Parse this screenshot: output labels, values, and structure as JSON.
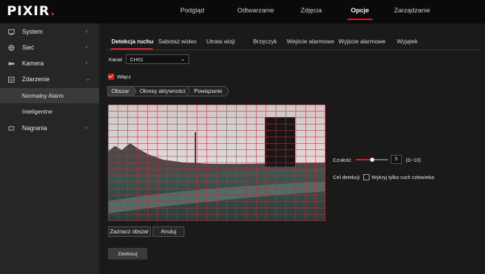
{
  "brand": {
    "logo_text": "PIXIR",
    "logo_dot": ".",
    "accent_color": "#d71920"
  },
  "topnav": {
    "items": [
      {
        "label": "Podgląd"
      },
      {
        "label": "Odtwarzanie"
      },
      {
        "label": "Zdjęcia"
      },
      {
        "label": "Opcje",
        "active": true
      },
      {
        "label": "Zarządzanie"
      }
    ]
  },
  "sidebar": {
    "items": [
      {
        "label": "System",
        "icon": "system-icon",
        "chevron": "›"
      },
      {
        "label": "Sieć",
        "icon": "network-icon",
        "chevron": "›"
      },
      {
        "label": "Kamera",
        "icon": "camera-icon",
        "chevron": "›"
      },
      {
        "label": "Zdarzenie",
        "icon": "event-icon",
        "chevron": "⌄",
        "expanded": true
      },
      {
        "label": "Nagrania",
        "icon": "recordings-icon",
        "chevron": "›"
      }
    ],
    "subitems": [
      {
        "label": "Normalny Alarm",
        "active": true
      },
      {
        "label": "Inteligentne"
      }
    ]
  },
  "tabs": [
    {
      "label": "Detekcja ruchu",
      "active": true
    },
    {
      "label": "Sabotaż wideo"
    },
    {
      "label": "Utrata wizji"
    },
    {
      "label": "Brzęczyk"
    },
    {
      "label": "Wejście alarmowe"
    },
    {
      "label": "Wyjście alarmowe"
    },
    {
      "label": "Wyjątek"
    }
  ],
  "channel": {
    "label": "Kanał",
    "value": "CH01"
  },
  "enable": {
    "label": "Włącz",
    "checked": true
  },
  "steps": [
    {
      "label": "Obszar",
      "active": true
    },
    {
      "label": "Okresy aktywności"
    },
    {
      "label": "Powiązanie"
    }
  ],
  "video": {
    "grid_columns": 22,
    "grid_rows": 18,
    "grid_color": "#e0202a"
  },
  "sensitivity": {
    "label": "Czułość",
    "value": "5",
    "range": "(0~10)",
    "level": 5,
    "min": 0,
    "max": 10
  },
  "detection_target": {
    "label": "Cel detekcji",
    "option_label": "Wykryj tylko ruch człowieka",
    "checked": false
  },
  "buttons": {
    "mark_area": "Zaznacz obszar",
    "cancel": "Anuluj",
    "apply": "Zastosuj"
  }
}
